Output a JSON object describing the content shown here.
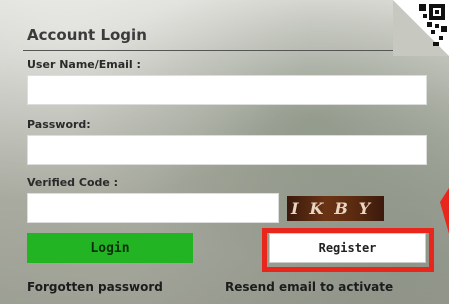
{
  "login_form": {
    "title": "Account Login",
    "username_label": "User Name/Email :",
    "password_label": "Password:",
    "code_label": "Verified Code :",
    "captcha_text": "IKBY",
    "login_label": "Login",
    "register_label": "Register",
    "forgot_label": "Forgotten password",
    "resend_label": "Resend email to activate"
  },
  "colors": {
    "login_button": "#22b422",
    "highlight": "#e8261b"
  },
  "icons": {
    "corner": "qr-code-icon"
  }
}
